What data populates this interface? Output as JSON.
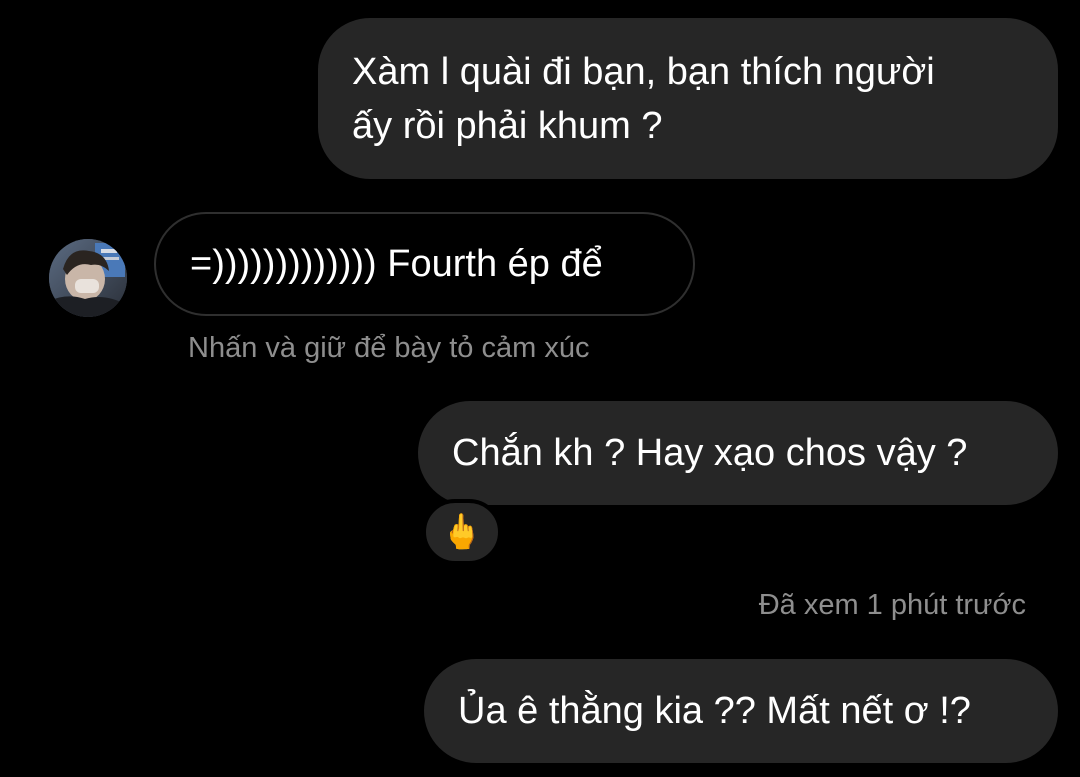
{
  "messages": [
    {
      "direction": "outgoing",
      "text_line1": "Xàm l quài đi bạn, bạn thích người",
      "text_line2": "ấy rồi phải khum ?"
    },
    {
      "direction": "incoming",
      "text": "=))))))))))))) Fourth ép để"
    },
    {
      "direction": "outgoing",
      "text": "Chắn kh ? Hay xạo chos vậy ?",
      "reaction": "🖕"
    },
    {
      "direction": "outgoing",
      "text": "Ủa ê thằng kia ?? Mất nết ơ !?"
    }
  ],
  "reaction_hint": "Nhấn và giữ để bày tỏ cảm xúc",
  "seen_status": "Đã xem 1 phút trước",
  "avatar_icon": "user-avatar-photo",
  "colors": {
    "background": "#000000",
    "outgoing_bubble": "#262626",
    "incoming_border": "#2f2f2f",
    "secondary_text": "#8e8e8e"
  }
}
